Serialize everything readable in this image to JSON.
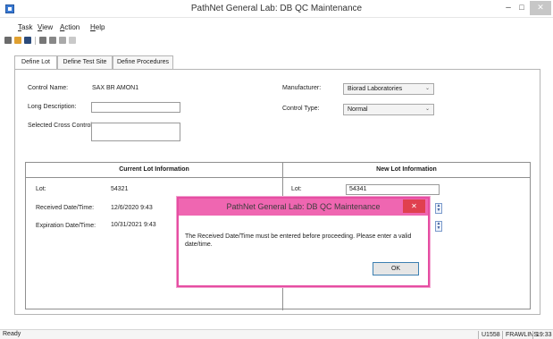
{
  "window": {
    "title": "PathNet General Lab: DB QC Maintenance",
    "minimize_glyph": "–",
    "maximize_glyph": "□",
    "close_glyph": "✕"
  },
  "menu": {
    "task": {
      "u": "T",
      "rest": "ask"
    },
    "view": {
      "u": "V",
      "rest": "iew"
    },
    "action": {
      "u": "A",
      "rest": "ction"
    },
    "help": {
      "u": "H",
      "rest": "elp"
    }
  },
  "toolbar": {
    "icons": [
      "save-all-icon",
      "open-folder-icon",
      "save-icon",
      "grid-icon",
      "list-icon",
      "comment-icon",
      "copy-icon"
    ]
  },
  "tabs": [
    {
      "label": "Define Lot"
    },
    {
      "label": "Define Test Site"
    },
    {
      "label": "Define Procedures"
    }
  ],
  "form": {
    "control_name_label": "Control Name:",
    "control_name_value": "SAX BR AMON1",
    "long_desc_label": "Long Description:",
    "long_desc_value": "",
    "cross_controls_label": "Selected Cross Controls:",
    "manufacturer_label": "Manufacturer:",
    "manufacturer_value": "Biorad Laboratories",
    "control_type_label": "Control Type:",
    "control_type_value": "Normal"
  },
  "current_lot": {
    "header": "Current Lot Information",
    "lot_label": "Lot:",
    "lot_value": "54321",
    "received_label": "Received Date/Time:",
    "received_value": "12/6/2020 9:43",
    "expiration_label": "Expiration Date/Time:",
    "expiration_value": "10/31/2021 9:43"
  },
  "new_lot": {
    "header": "New Lot Information",
    "lot_label": "Lot:",
    "lot_value": "54341"
  },
  "dialog": {
    "title": "PathNet General Lab: DB QC Maintenance",
    "close_glyph": "✕",
    "message": "The Received Date/Time must be entered before proceeding. Please enter a valid date/time.",
    "ok_label": "OK"
  },
  "status": {
    "text": "Ready",
    "code": "U1558",
    "user": "FRAWLINS",
    "time": "19:33"
  },
  "colors": {
    "dialog_border": "#e64ea3",
    "dialog_title_bg": "#ef66b1",
    "dialog_close_bg": "#e0404f"
  }
}
